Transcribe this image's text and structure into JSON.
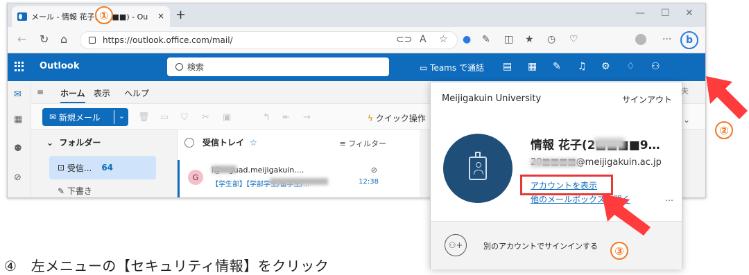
{
  "browser": {
    "tab_title": "メール - 情報 花子(■■■■) - Ou",
    "url": "https://outlook.office.com/mail/",
    "new_tab": "+",
    "close": "×"
  },
  "outlook": {
    "brand": "Outlook",
    "search_placeholder": "検索",
    "teams_label": "Teams で通話",
    "ribbon_tabs": [
      "ホーム",
      "表示",
      "ヘルプ"
    ],
    "new_mail": "新規メール",
    "quick_steps": "クイック操作",
    "folders_header": "フォルダー",
    "inbox_label": "受信...",
    "inbox_count": "64",
    "drafts_label": "下書き",
    "list_title": "受信トレイ",
    "filter_label": "フィルター",
    "message": {
      "avatar": "G",
      "sender": "i@mguad.meijigakuin....",
      "subject": "【学生部】【学部学生/留学生/...",
      "time": "12:38"
    }
  },
  "account_popup": {
    "org": "Meijigakuin University",
    "signout": "サインアウト",
    "name": "情報 花子(2■■■■9…",
    "email": "20■■■■@meijigakuin.ac.jp",
    "view_account": "アカウントを表示",
    "other_mailbox": "他のメールボックスを開く",
    "more": "…",
    "add_account": "別のアカウントでサインインする"
  },
  "annotations": {
    "step1": "①",
    "step2": "②",
    "step3": "③",
    "step4_text": "④　左メニューの【セキュリティ情報】をクリック",
    "accent_color": "#f07a24",
    "highlight_color": "#e53935"
  }
}
